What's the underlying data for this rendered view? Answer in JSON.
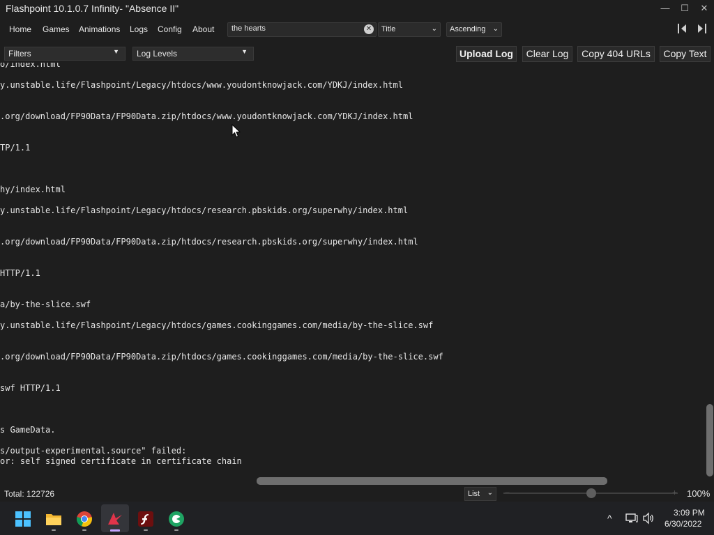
{
  "window": {
    "title": "Flashpoint 10.1.0.7 Infinity- \"Absence II\"",
    "minimize_glyph": "—",
    "maximize_glyph": "☐",
    "close_glyph": "✕"
  },
  "nav": {
    "items": [
      {
        "label": "Home"
      },
      {
        "label": "Games"
      },
      {
        "label": "Animations"
      },
      {
        "label": "Logs"
      },
      {
        "label": "Config"
      },
      {
        "label": "About"
      }
    ],
    "search": {
      "value": "the hearts",
      "clear_icon": "clear-icon"
    },
    "sort_field": "Title",
    "sort_order": "Ascending",
    "chevron_glyph": "⌄"
  },
  "log_toolbar": {
    "filters_label": "Filters",
    "log_levels_label": "Log Levels",
    "dropdown_glyph": "▼",
    "upload_log": "Upload Log",
    "clear_log": "Clear Log",
    "copy_404": "Copy 404 URLs",
    "copy_text": "Copy Text"
  },
  "log_lines": [
    "o/index.html",
    "y.unstable.life/Flashpoint/Legacy/htdocs/www.youdontknowjack.com/YDKJ/index.html",
    ".org/download/FP90Data/FP90Data.zip/htdocs/www.youdontknowjack.com/YDKJ/index.html",
    "TP/1.1",
    "hy/index.html",
    "y.unstable.life/Flashpoint/Legacy/htdocs/research.pbskids.org/superwhy/index.html",
    ".org/download/FP90Data/FP90Data.zip/htdocs/research.pbskids.org/superwhy/index.html",
    "HTTP/1.1",
    "a/by-the-slice.swf",
    "y.unstable.life/Flashpoint/Legacy/htdocs/games.cookinggames.com/media/by-the-slice.swf",
    ".org/download/FP90Data/FP90Data.zip/htdocs/games.cookinggames.com/media/by-the-slice.swf",
    "swf HTTP/1.1",
    "s GameData.",
    "s/output-experimental.source\" failed:",
    "or: self signed certificate in certificate chain"
  ],
  "status": {
    "total": "Total: 122726",
    "view_mode": "List",
    "zoom_minus": "−",
    "zoom_plus": "+",
    "zoom_percent": "100%",
    "zoom_level_fraction": 0.5
  },
  "taskbar": {
    "apps": [
      {
        "name": "Start"
      },
      {
        "name": "File Explorer"
      },
      {
        "name": "Google Chrome"
      },
      {
        "name": "Flashpoint Launcher"
      },
      {
        "name": "Adobe Flash"
      },
      {
        "name": "Browser"
      }
    ],
    "tray": {
      "chevron": "^",
      "network": "🖧",
      "volume": "🔊"
    },
    "time": "3:09 PM",
    "date": "6/30/2022"
  }
}
